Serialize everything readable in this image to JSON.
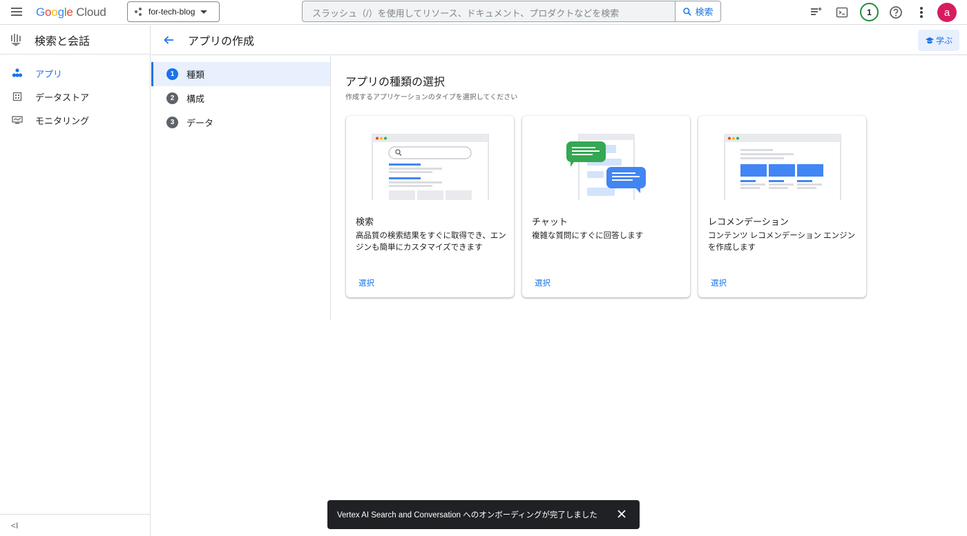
{
  "topbar": {
    "logo": {
      "g1": "G",
      "g2": "o",
      "g3": "o",
      "g4": "g",
      "g5": "l",
      "g6": "e",
      "cloud": "Cloud"
    },
    "project": "for-tech-blog",
    "search_placeholder": "スラッシュ（/）を使用してリソース、ドキュメント、プロダクトなどを検索",
    "search_button": "検索",
    "notification_count": "1",
    "avatar_letter": "a"
  },
  "sidebar": {
    "title": "検索と会話",
    "items": [
      {
        "label": "アプリ",
        "icon": "apps-icon",
        "active": true
      },
      {
        "label": "データストア",
        "icon": "data-store-icon",
        "active": false
      },
      {
        "label": "モニタリング",
        "icon": "monitoring-icon",
        "active": false
      }
    ],
    "collapse_label": "<I"
  },
  "page": {
    "title": "アプリの作成",
    "learn_label": "学ぶ"
  },
  "stepper": [
    {
      "num": "1",
      "label": "種類",
      "active": true
    },
    {
      "num": "2",
      "label": "構成",
      "active": false
    },
    {
      "num": "3",
      "label": "データ",
      "active": false
    }
  ],
  "main": {
    "heading": "アプリの種類の選択",
    "subheading": "作成するアプリケーションのタイプを選択してください",
    "cards": [
      {
        "title": "検索",
        "desc": "高品質の検索結果をすぐに取得でき、エンジンも簡単にカスタマイズできます",
        "select": "選択"
      },
      {
        "title": "チャット",
        "desc": "複雑な質問にすぐに回答します",
        "select": "選択"
      },
      {
        "title": "レコメンデーション",
        "desc": "コンテンツ レコメンデーション エンジンを作成します",
        "select": "選択"
      }
    ]
  },
  "snackbar": {
    "message": "Vertex AI Search and Conversation へのオンボーディングが完了しました"
  },
  "colors": {
    "accent": "#1a73e8",
    "avatar": "#d81b60",
    "chat_green": "#34a853",
    "chat_blue": "#4285f4"
  }
}
